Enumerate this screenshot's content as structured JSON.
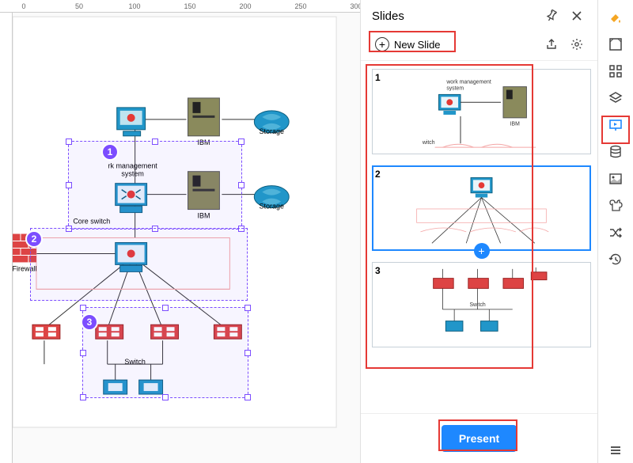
{
  "ruler": {
    "marks": [
      0,
      50,
      100,
      150,
      200,
      250,
      300
    ]
  },
  "canvas": {
    "labels": {
      "ibm": "IBM",
      "storage": "Storage",
      "network_mgmt": "rk management\nsystem",
      "core_switch": "Core switch",
      "firewall": "Firewall",
      "switch": "Switch"
    },
    "markers": {
      "m1": "1",
      "m2": "2",
      "m3": "3"
    }
  },
  "panel": {
    "title": "Slides",
    "new_slide_label": "New Slide",
    "thumbs": [
      {
        "num": "1",
        "labels": {
          "network_mgmt": "work management\nsystem",
          "ibm": "IBM",
          "witch": "witch"
        }
      },
      {
        "num": "2"
      },
      {
        "num": "3",
        "labels": {
          "switch": "Switch"
        }
      }
    ],
    "present": "Present"
  },
  "rail": {
    "icons": [
      "fill-icon",
      "format-icon",
      "grid-icon",
      "layers-icon",
      "presentation-icon",
      "data-icon",
      "image-icon",
      "plugin-icon",
      "shuffle-icon",
      "history-icon"
    ]
  }
}
